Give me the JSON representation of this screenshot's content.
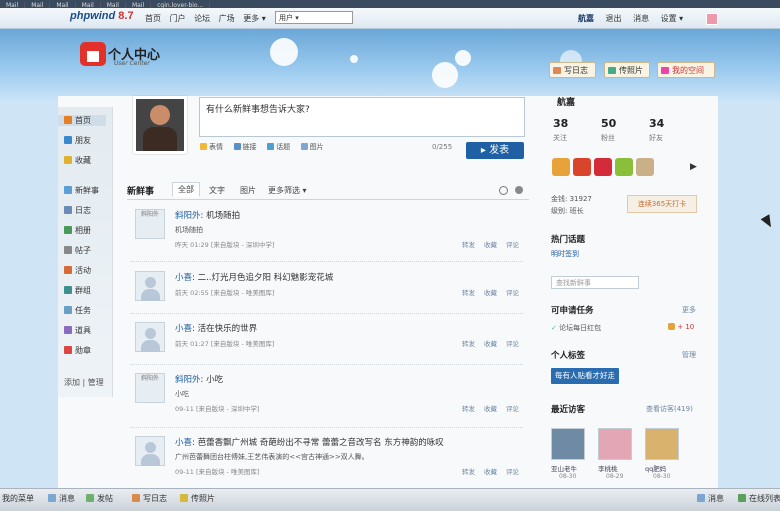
{
  "browser_tabs": [
    "Mail",
    "Mail",
    "Mail",
    "Mail",
    "Mail",
    "Mail",
    "cgin.lover-bio..."
  ],
  "topnav": {
    "logo": "phpwind",
    "version": "8.7",
    "links": [
      "首页",
      "门户",
      "论坛",
      "广场",
      "更多 ▾"
    ],
    "user_select": "用户 ▾",
    "username": "航嘉",
    "right_links": [
      "退出",
      "消息",
      "设置 ▾"
    ]
  },
  "header": {
    "title": "个人中心",
    "subtitle": "User Center",
    "buttons": [
      "写日志",
      "传照片",
      "我的空间"
    ]
  },
  "sidebar": {
    "items": [
      {
        "label": "首页",
        "icon": "home-icon",
        "color": "#e67e22"
      },
      {
        "label": "朋友",
        "icon": "friends-icon",
        "color": "#3b8ad0"
      },
      {
        "label": "收藏",
        "icon": "star-icon",
        "color": "#e0b12c"
      },
      {
        "label": "新鲜事",
        "icon": "news-icon",
        "color": "#5aa0d6"
      },
      {
        "label": "日志",
        "icon": "blog-icon",
        "color": "#6b8bb5"
      },
      {
        "label": "相册",
        "icon": "album-icon",
        "color": "#4a9a5a"
      },
      {
        "label": "帖子",
        "icon": "post-icon",
        "color": "#888888"
      },
      {
        "label": "活动",
        "icon": "activity-icon",
        "color": "#d66b3a"
      },
      {
        "label": "群组",
        "icon": "group-icon",
        "color": "#3f8f8f"
      },
      {
        "label": "任务",
        "icon": "task-icon",
        "color": "#6a9fc4"
      },
      {
        "label": "道具",
        "icon": "tool-icon",
        "color": "#8a6bbd"
      },
      {
        "label": "勋章",
        "icon": "medal-icon",
        "color": "#d44"
      }
    ],
    "bottom": "添加 | 管理"
  },
  "compose": {
    "placeholder": "有什么新鲜事想告诉大家?",
    "tools": [
      "表情",
      "链接",
      "话题",
      "图片"
    ],
    "count": "0/255",
    "submit": "▸ 发表"
  },
  "feed": {
    "title": "新鲜事",
    "tabs": [
      "全部",
      "文字",
      "图片",
      "更多筛选 ▾"
    ],
    "items": [
      {
        "avatar": "斜阳外",
        "author": "斜阳外",
        "headline": ": 机场随拍",
        "body": "机场随拍",
        "meta": "昨天 01:29 [来自版块 - 深圳中学]"
      },
      {
        "avatar": "",
        "author": "小喜",
        "headline": ": 二..灯光月色追夕阳  科幻魅影宠花城",
        "body": "",
        "meta": "前天 02:55 [来自版块 - 唯美图库]"
      },
      {
        "avatar": "",
        "author": "小喜",
        "headline": ": 活在快乐的世界",
        "body": "",
        "meta": "前天 01:27 [来自版块 - 唯美图库]"
      },
      {
        "avatar": "斜阳外",
        "author": "斜阳外",
        "headline": ": 小吃",
        "body": "小吃",
        "meta": "09-11 [来自版块 - 深圳中学]"
      },
      {
        "avatar": "",
        "author": "小喜",
        "headline": ": 芭蕾香飘广州城  奇葩纷出不寻常 蕾蕾之音改写名 东方神韵的咏叹",
        "body": "广州芭蕾舞团台柱傅妹,王艺伟表演的<<宫古神通>>双人舞。",
        "meta": "09-11 [来自版块 - 唯美图库]"
      }
    ],
    "actions": [
      "转发",
      "收藏",
      "评论"
    ]
  },
  "profile": {
    "name": "航嘉",
    "stats": [
      {
        "value": "38",
        "label": "关注"
      },
      {
        "value": "50",
        "label": "粉丝"
      },
      {
        "value": "34",
        "label": "好友"
      }
    ],
    "medal_colors": [
      "#e8a23a",
      "#d9442c",
      "#d42b3a",
      "#8bbf3a",
      "#c9b089"
    ],
    "gold": "金钱: 31927",
    "level": "级别: 班长",
    "sign_btn": "连续365天打卡",
    "hot_title": "热门话题",
    "hot_link": "明时签到",
    "search_placeholder": "查找新鲜事",
    "task_title": "可申请任务",
    "task_more": "更多",
    "task_item": "论坛每日红包",
    "task_reward": "+ 10",
    "tags_title": "个人标签",
    "tags_manage": "管理",
    "tag_btn": "每有人贴看才好走",
    "visitors_title": "最近访客",
    "visitors_more": "查看访客(419)",
    "visitors": [
      {
        "name": "亚山老牛",
        "time": "08-30",
        "color": "#6f8aa5"
      },
      {
        "name": "李桃桃",
        "time": "08-29",
        "color": "#e2a6b5"
      },
      {
        "name": "qq肥妈",
        "time": "08-30",
        "color": "#d9b26d"
      }
    ]
  },
  "taskbar": {
    "items": [
      "我的菜单",
      "消息",
      "发帖",
      "写日志",
      "传照片"
    ],
    "right": [
      "消息",
      "在线列表"
    ]
  }
}
